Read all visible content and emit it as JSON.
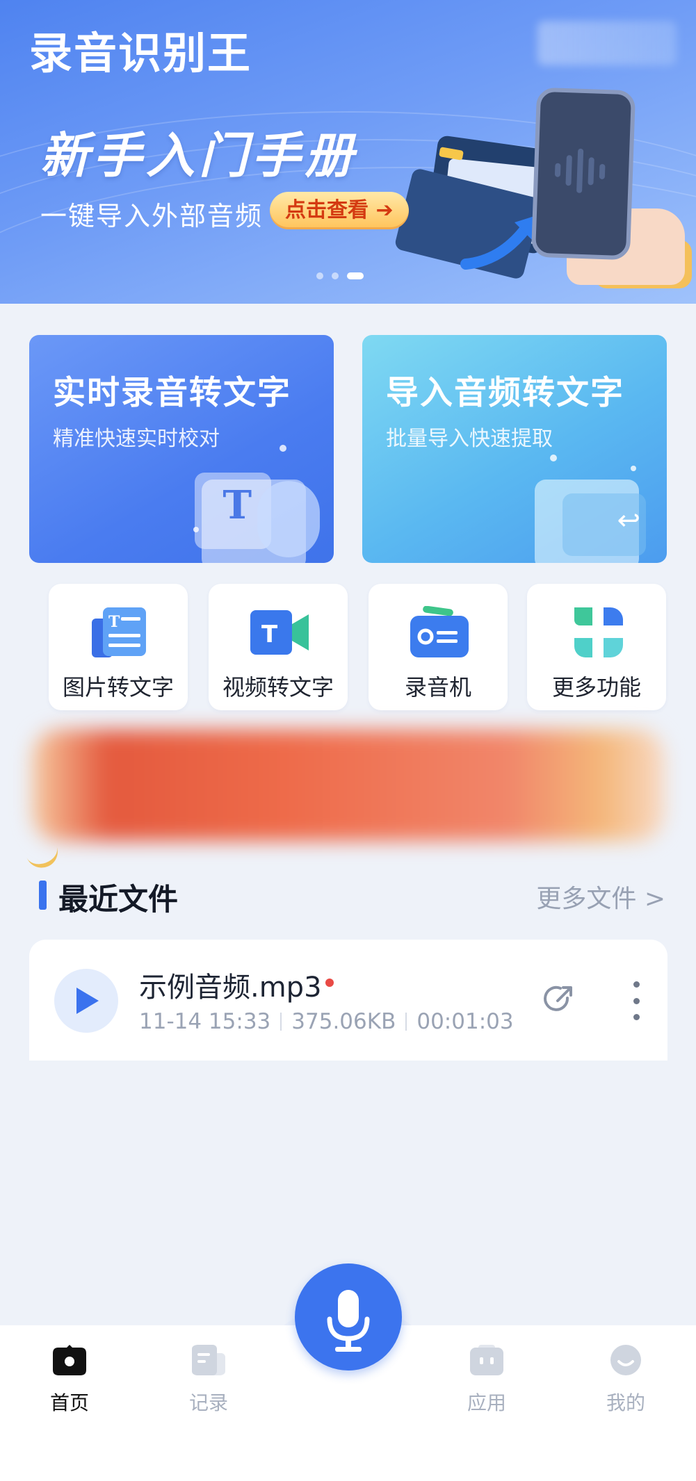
{
  "header": {
    "app_title": "录音识别王",
    "banner": {
      "headline": "新手入门手册",
      "subtitle": "一键导入外部音频",
      "cta_label": "点击查看",
      "cta_arrow": "➔",
      "page_count": 3,
      "active_page": 3
    }
  },
  "feature_cards": [
    {
      "title": "实时录音转文字",
      "subtitle": "精准快速实时校对"
    },
    {
      "title": "导入音频转文字",
      "subtitle": "批量导入快速提取"
    }
  ],
  "tools": [
    {
      "label": "图片转文字",
      "icon": "image-text-icon"
    },
    {
      "label": "视频转文字",
      "icon": "video-text-icon"
    },
    {
      "label": "录音机",
      "icon": "recorder-icon"
    },
    {
      "label": "更多功能",
      "icon": "grid-more-icon"
    }
  ],
  "recent": {
    "title": "最近文件",
    "more_link": "更多文件 >",
    "files": [
      {
        "name": "示例音频.mp3",
        "date": "11-14 15:33",
        "size": "375.06KB",
        "duration": "00:01:03",
        "unread": true
      }
    ]
  },
  "nav": {
    "items": [
      {
        "label": "首页",
        "icon": "home-icon",
        "active": true
      },
      {
        "label": "记录",
        "icon": "records-icon",
        "active": false
      },
      {
        "label": "应用",
        "icon": "apps-icon",
        "active": false
      },
      {
        "label": "我的",
        "icon": "profile-icon",
        "active": false
      }
    ],
    "center_icon": "microphone-icon"
  },
  "colors": {
    "accent": "#3c74ee",
    "banner_start": "#4f83f0",
    "unread_dot": "#e94a45",
    "cta_text": "#d43a11"
  }
}
